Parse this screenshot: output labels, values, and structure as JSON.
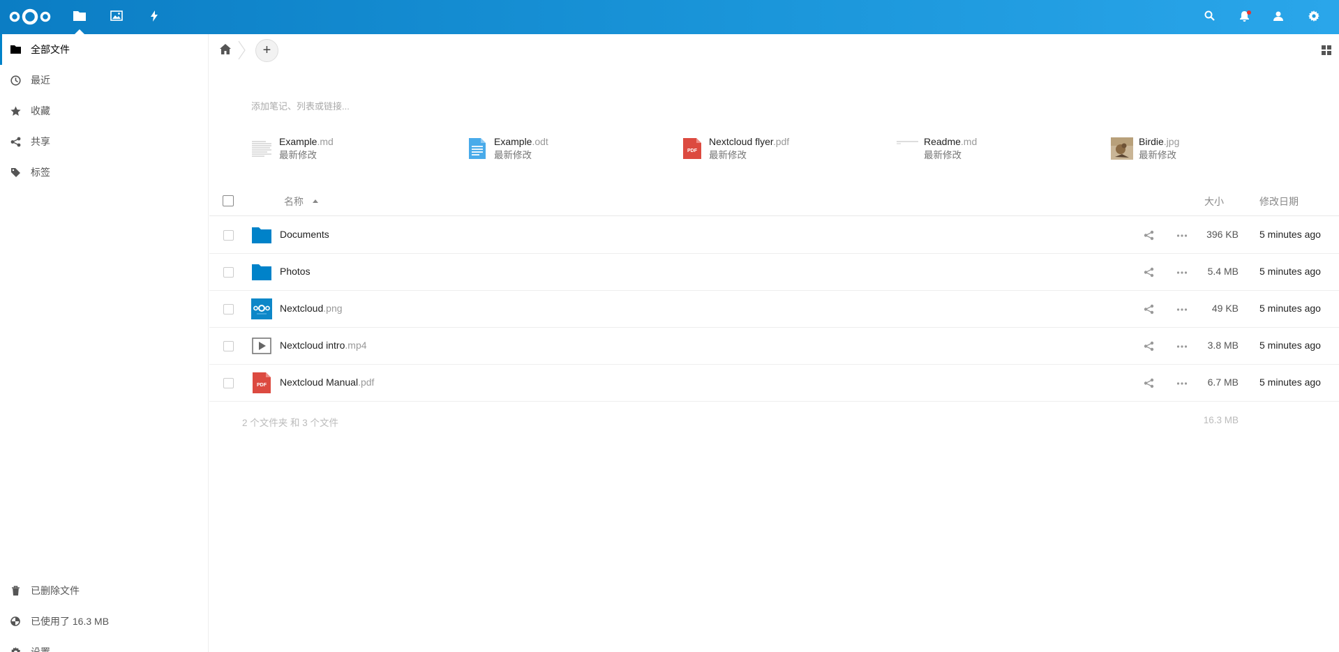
{
  "header": {
    "apps": [
      {
        "name": "files",
        "icon": "folder-icon"
      },
      {
        "name": "photos",
        "icon": "image-icon"
      },
      {
        "name": "activity",
        "icon": "lightning-icon"
      }
    ],
    "right_icons": [
      "search-icon",
      "notifications-icon",
      "contacts-icon",
      "settings-icon"
    ],
    "brand_color": "#0082c9"
  },
  "sidebar": {
    "items": [
      {
        "label": "全部文件",
        "icon": "folder-icon",
        "active": true
      },
      {
        "label": "最近",
        "icon": "clock-icon"
      },
      {
        "label": "收藏",
        "icon": "star-icon"
      },
      {
        "label": "共享",
        "icon": "share-icon"
      },
      {
        "label": "标签",
        "icon": "tag-icon"
      }
    ],
    "bottom": {
      "trash": "已删除文件",
      "quota": "已使用了 16.3 MB",
      "settings": "设置"
    }
  },
  "main": {
    "note_placeholder": "添加笔记、列表或链接...",
    "recent": [
      {
        "base": "Example",
        "ext": ".md",
        "sub": "最新修改"
      },
      {
        "base": "Example",
        "ext": ".odt",
        "sub": "最新修改"
      },
      {
        "base": "Nextcloud flyer",
        "ext": ".pdf",
        "sub": "最新修改"
      },
      {
        "base": "Readme",
        "ext": ".md",
        "sub": "最新修改"
      },
      {
        "base": "Birdie",
        "ext": ".jpg",
        "sub": "最新修改"
      }
    ],
    "table": {
      "col_name": "名称",
      "col_size": "大小",
      "col_date": "修改日期",
      "rows": [
        {
          "base": "Documents",
          "ext": "",
          "size": "396 KB",
          "date": "5 minutes ago",
          "type": "folder"
        },
        {
          "base": "Photos",
          "ext": "",
          "size": "5.4 MB",
          "date": "5 minutes ago",
          "type": "folder"
        },
        {
          "base": "Nextcloud",
          "ext": ".png",
          "size": "49 KB",
          "date": "5 minutes ago",
          "type": "image"
        },
        {
          "base": "Nextcloud intro",
          "ext": ".mp4",
          "size": "3.8 MB",
          "date": "5 minutes ago",
          "type": "video"
        },
        {
          "base": "Nextcloud Manual",
          "ext": ".pdf",
          "size": "6.7 MB",
          "date": "5 minutes ago",
          "type": "pdf"
        }
      ],
      "summary_count": "2 个文件夹 和 3 个文件",
      "summary_size": "16.3 MB"
    }
  }
}
